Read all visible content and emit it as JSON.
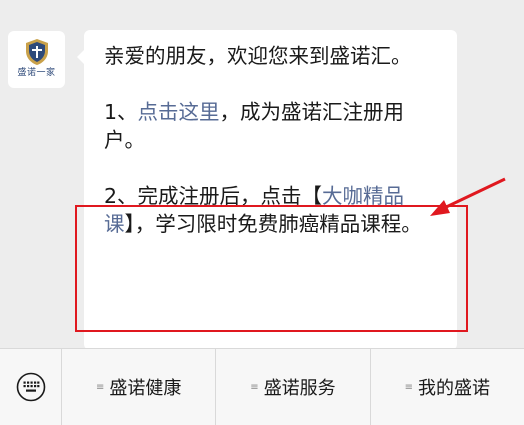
{
  "avatar": {
    "label": "盛诺一家",
    "icon": "shield-logo"
  },
  "message": {
    "line1": "亲爱的朋友，欢迎您来到盛诺汇。",
    "item1_prefix": "1、",
    "item1_link": "点击这里",
    "item1_suffix": "，成为盛诺汇注册用户。",
    "item2_prefix": "2、完成注册后，点击【",
    "item2_link": "大咖精品课",
    "item2_suffix": "】，学习限时免费肺癌精品课程。",
    "link_color": "#576b95"
  },
  "annotation": {
    "color": "#e0181f"
  },
  "menu": {
    "keyboard_icon": "keyboard-icon",
    "items": [
      {
        "label": "盛诺健康",
        "icon": "menu-lines-icon"
      },
      {
        "label": "盛诺服务",
        "icon": "menu-lines-icon"
      },
      {
        "label": "我的盛诺",
        "icon": "menu-lines-icon"
      }
    ]
  }
}
